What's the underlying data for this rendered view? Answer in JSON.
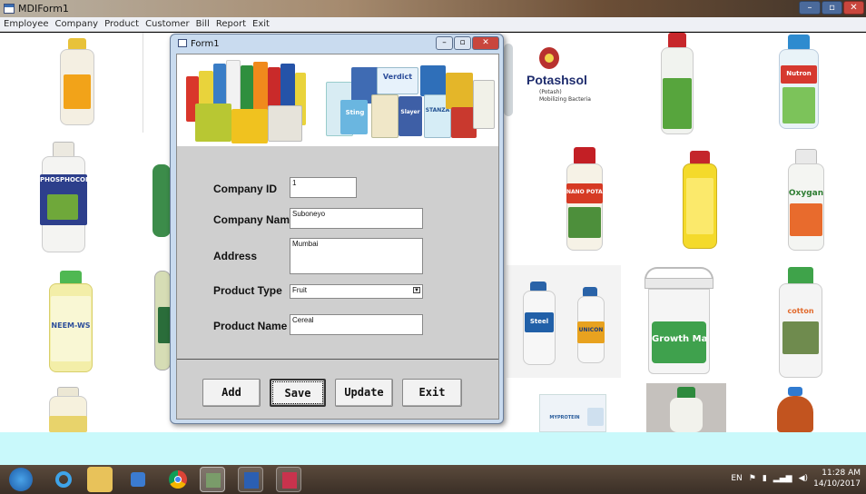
{
  "mdi": {
    "title": "MDIForm1",
    "window_controls": {
      "minimize": "–",
      "maximize": "▫",
      "close": "✕"
    }
  },
  "menu": [
    "Employee",
    "Company",
    "Product",
    "Customer",
    "Bill",
    "Report",
    "Exit"
  ],
  "background_products": [
    {
      "name": "Potashsol",
      "sub": "(Potash)",
      "desc": "Mobilizing Bacteria"
    },
    {
      "name": "PHOSPHOCOP"
    },
    {
      "name": "NEEM-WS"
    },
    {
      "name": "NANO POTASH"
    },
    {
      "name": "Oxygan"
    },
    {
      "name": "Nutron"
    },
    {
      "name": "Steel"
    },
    {
      "name": "UNICON"
    },
    {
      "name": "Growth Master"
    },
    {
      "name": "cotton"
    },
    {
      "name": "MYPROTEIN"
    }
  ],
  "form": {
    "title": "Form1",
    "window_controls": {
      "minimize": "–",
      "maximize": "▫",
      "close": "✕"
    },
    "banner_packs": [
      "Verdict",
      "Sting",
      "Slayer",
      "STANZA"
    ],
    "fields": {
      "company_id": {
        "label": "Company ID",
        "value": "1"
      },
      "company_name": {
        "label": "Company Name",
        "value": "Suboneyo"
      },
      "address": {
        "label": "Address",
        "value": "Mumbai"
      },
      "product_type": {
        "label": "Product Type",
        "value": "Fruit"
      },
      "product_name": {
        "label": "Product Name",
        "value": "Cereal"
      }
    },
    "buttons": {
      "add": "Add",
      "save": "Save",
      "update": "Update",
      "exit": "Exit"
    }
  },
  "taskbar": {
    "language": "EN",
    "time": "11:28 AM",
    "date": "14/10/2017"
  },
  "colors": {
    "form_client": "#cfcfcf",
    "mdi_client": "#ffffff",
    "status_strip": "#c9f9fb"
  }
}
